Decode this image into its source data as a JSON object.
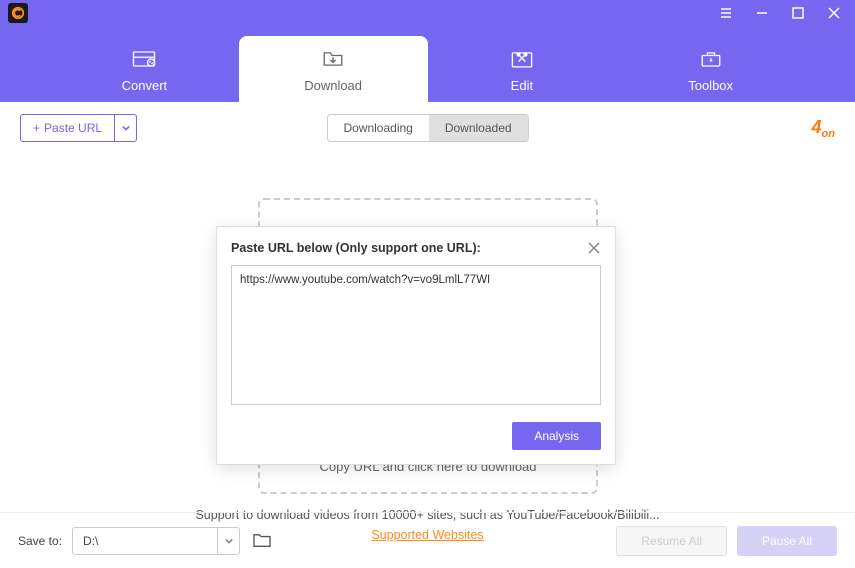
{
  "nav": {
    "convert": "Convert",
    "download": "Download",
    "edit": "Edit",
    "toolbox": "Toolbox"
  },
  "toolbar": {
    "paste_url": "Paste URL"
  },
  "segments": {
    "downloading": "Downloading",
    "downloaded": "Downloaded"
  },
  "brand": {
    "big": "4",
    "small": "on"
  },
  "dropzone": {
    "hint": "Copy URL and click here to download"
  },
  "support": {
    "line": "Support to download videos from 10000+ sites, such as YouTube/Facebook/Bilibili...",
    "link": "Supported Websites"
  },
  "modal": {
    "title": "Paste URL below (Only support one URL):",
    "url": "https://www.youtube.com/watch?v=vo9LmlL77WI",
    "analysis": "Analysis"
  },
  "bottom": {
    "save_to": "Save to:",
    "path": "D:\\",
    "resume": "Resume All",
    "pause": "Pause All"
  }
}
